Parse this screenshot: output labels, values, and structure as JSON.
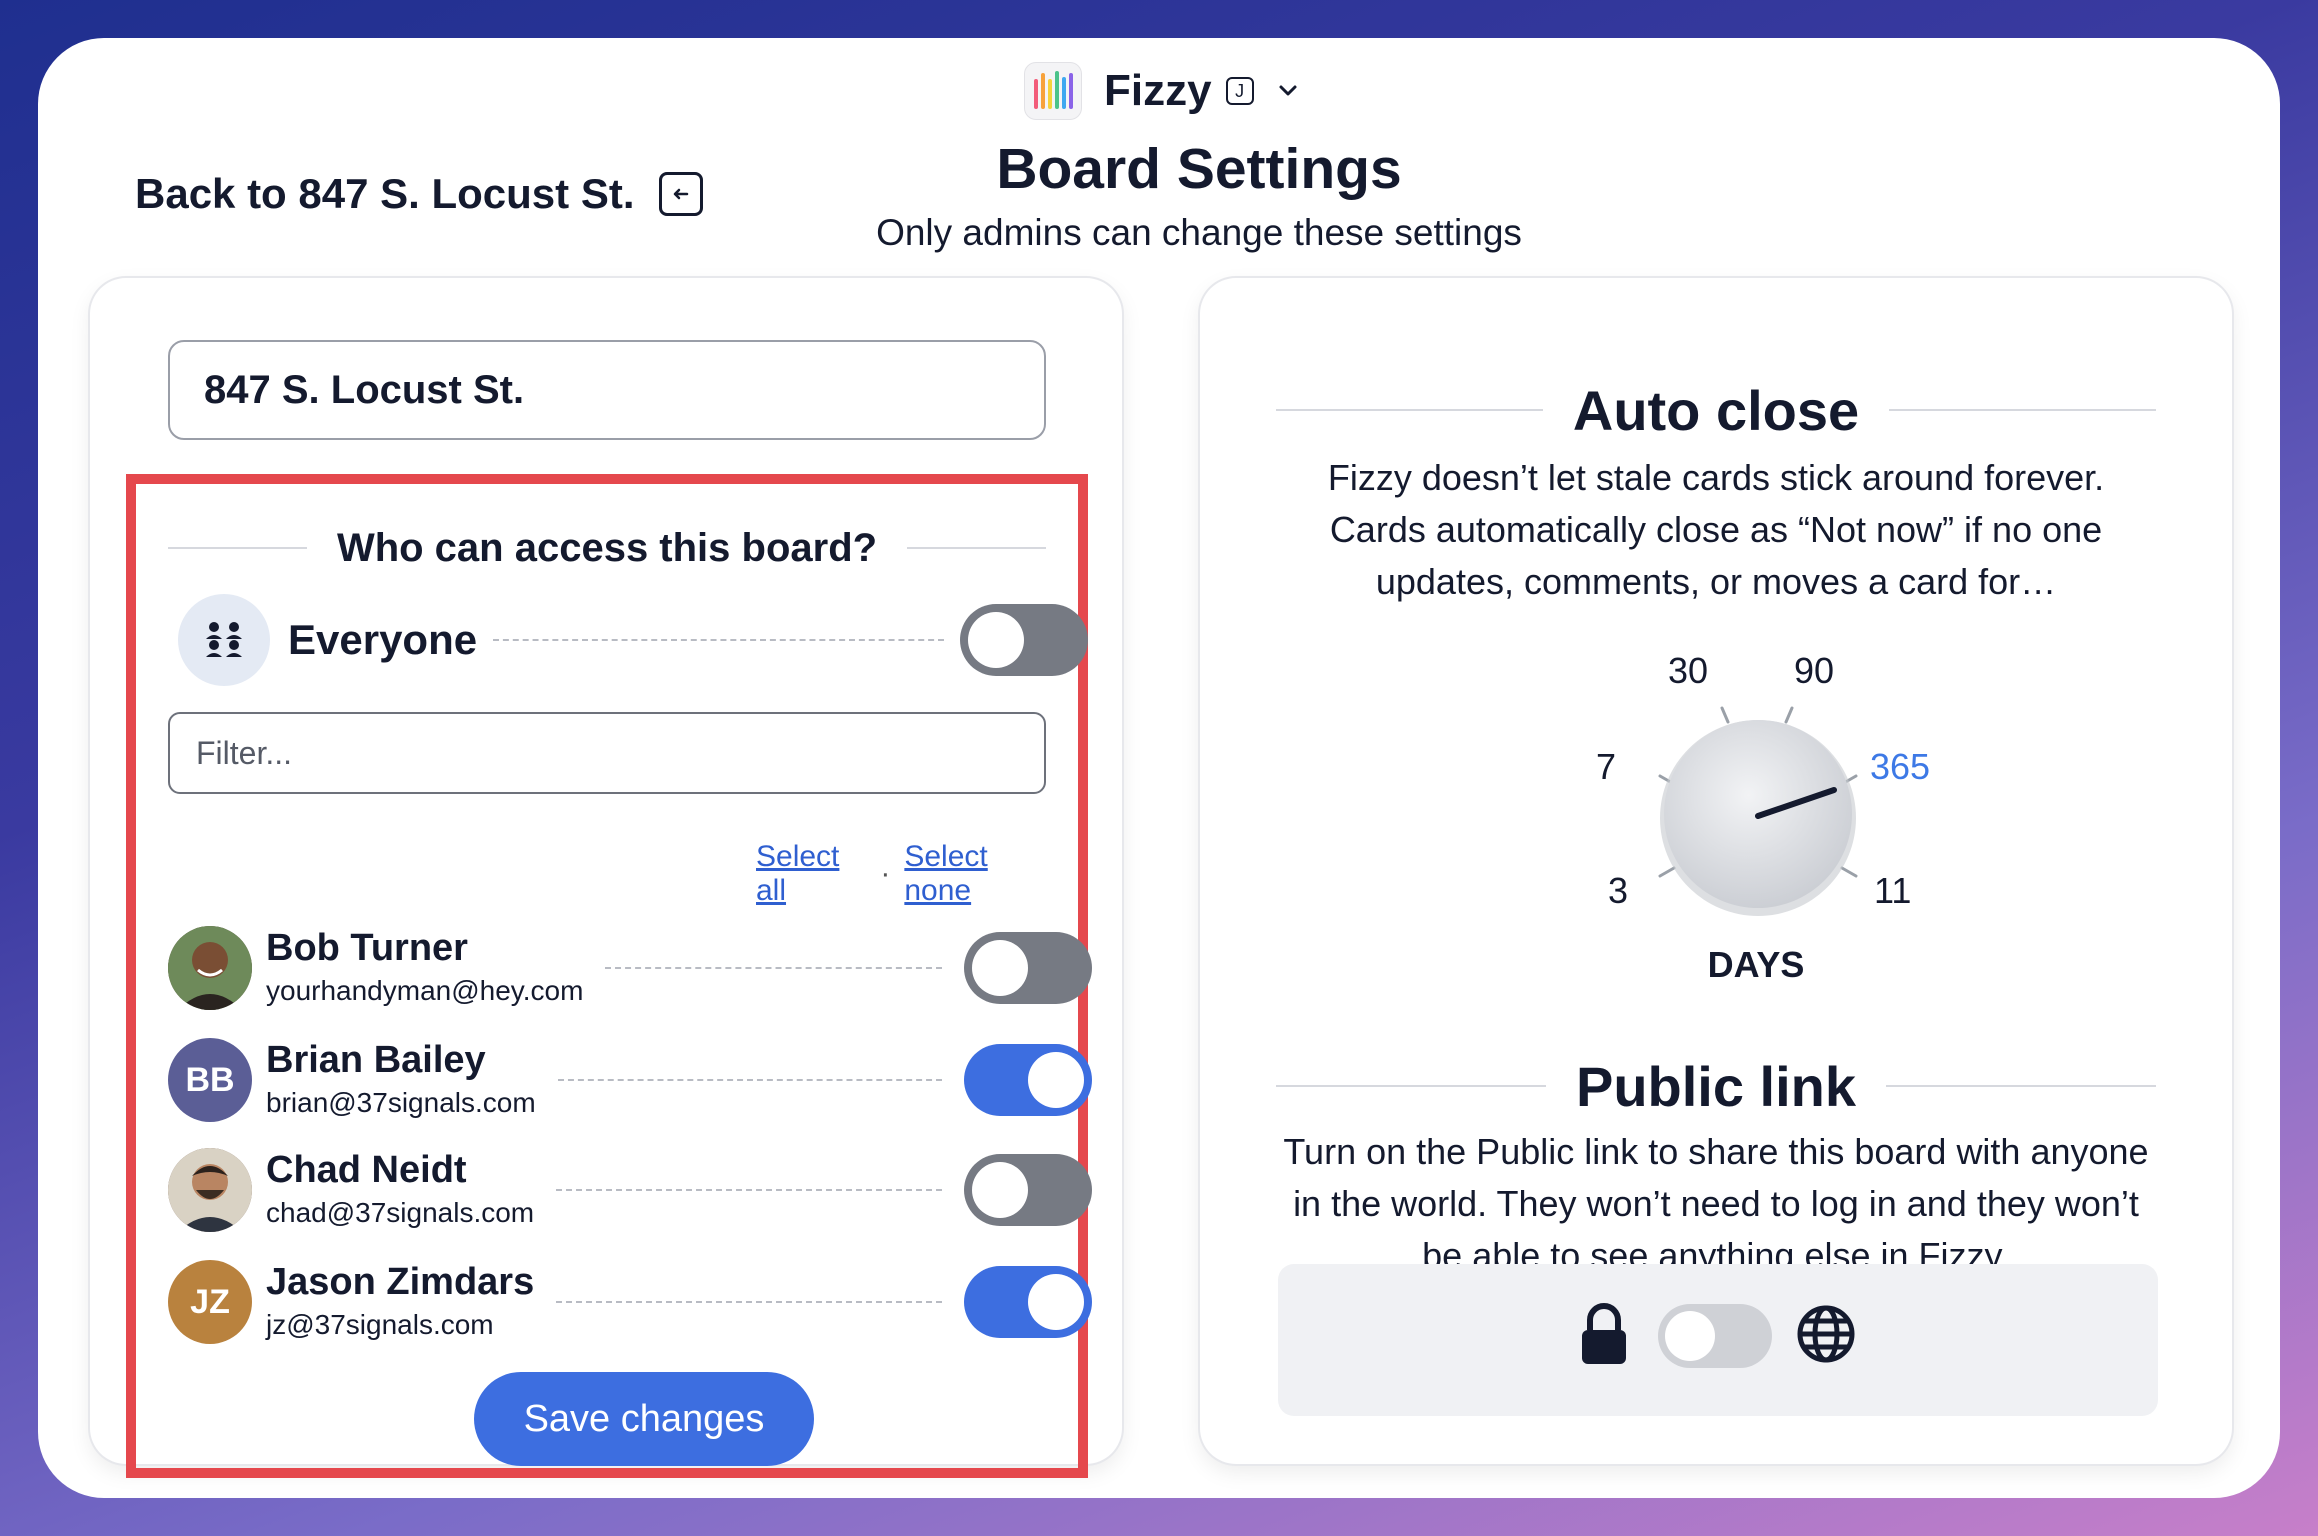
{
  "app": {
    "name": "Fizzy",
    "shortcut_key": "J"
  },
  "nav": {
    "back_label": "Back to 847 S. Locust St."
  },
  "page": {
    "title": "Board Settings",
    "subtitle": "Only admins can change these settings"
  },
  "board": {
    "name": "847 S. Locust St."
  },
  "access": {
    "heading": "Who can access this board?",
    "everyone_label": "Everyone",
    "everyone_on": false,
    "filter_placeholder": "Filter...",
    "select_all": "Select all",
    "select_separator": "·",
    "select_none": "Select none",
    "users": [
      {
        "name": "Bob Turner",
        "email": "yourhandyman@hey.com",
        "initials": "",
        "avatar_color": "#5a3a2a",
        "access": false
      },
      {
        "name": "Brian Bailey",
        "email": "brian@37signals.com",
        "initials": "BB",
        "avatar_color": "#5b5e96",
        "access": true
      },
      {
        "name": "Chad Neidt",
        "email": "chad@37signals.com",
        "initials": "",
        "avatar_color": "#6b5040",
        "access": false
      },
      {
        "name": "Jason Zimdars",
        "email": "jz@37signals.com",
        "initials": "JZ",
        "avatar_color": "#b9823e",
        "access": true
      }
    ],
    "save_label": "Save changes"
  },
  "auto_close": {
    "heading": "Auto close",
    "description": "Fizzy doesn’t let stale cards stick around forever. Cards automatically close as “Not now” if no one updates, comments, or moves a card for…",
    "options": [
      "3",
      "7",
      "30",
      "90",
      "365",
      "11"
    ],
    "selected": "365",
    "unit_label": "DAYS"
  },
  "public_link": {
    "heading": "Public link",
    "description": "Turn on the Public link to share this board with anyone in the world. They won’t need to log in and they won’t be able to see anything else in Fizzy.",
    "enabled": false
  },
  "colors": {
    "accent": "#3d6ee0",
    "highlight": "#e5484d",
    "selected_option": "#3d79e6"
  }
}
